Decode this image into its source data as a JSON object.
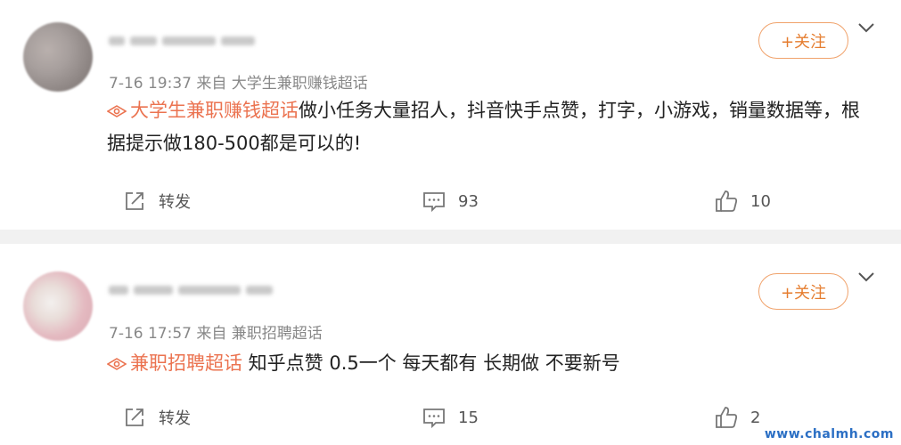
{
  "posts": [
    {
      "meta": "7-16 19:37  来自 大学生兼职赚钱超话",
      "topic": "大学生兼职赚钱超话",
      "body": "做小任务大量招人，抖音快手点赞，打字，小游戏，销量数据等，根据提示做180-500都是可以的!",
      "follow_label": "+关注",
      "repost_label": "转发",
      "comment_count": "93",
      "like_count": "10",
      "icons": [
        "repost-icon",
        "comment-icon",
        "like-icon",
        "chevron-down-icon",
        "topic-icon"
      ]
    },
    {
      "meta": "7-16 17:57  来自 兼职招聘超话",
      "topic": "兼职招聘超话",
      "body": " 知乎点赞 0.5一个 每天都有 长期做 不要新号",
      "follow_label": "+关注",
      "repost_label": "转发",
      "comment_count": "15",
      "like_count": "2",
      "icons": [
        "repost-icon",
        "comment-icon",
        "like-icon",
        "chevron-down-icon",
        "topic-icon"
      ]
    }
  ],
  "watermark": "www.chalmh.com",
  "colors": {
    "accent": "#eb7350",
    "follow_border": "#f0a26b",
    "divider": "#f1f1f1",
    "watermark": "#2b6fc4"
  }
}
